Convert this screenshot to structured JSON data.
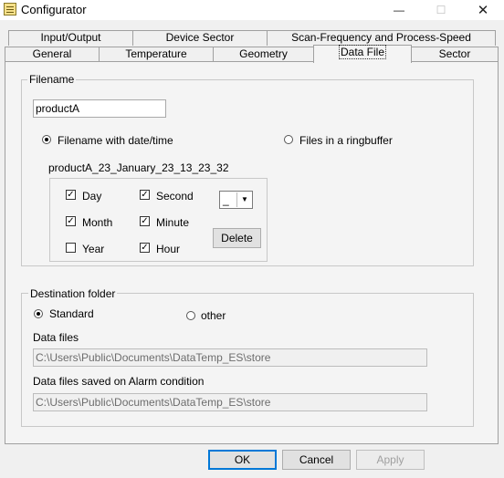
{
  "window": {
    "title": "Configurator",
    "minimize": "—",
    "maximize": "☐",
    "close": "✕"
  },
  "tabs": {
    "row1": [
      "Input/Output",
      "Device Sector",
      "Scan-Frequency and Process-Speed"
    ],
    "row2": [
      "General",
      "Temperature",
      "Geometry",
      "Data File",
      "Sector"
    ],
    "active": "Data File"
  },
  "filename": {
    "legend": "Filename",
    "value": "productA",
    "with_date_label": "Filename with date/time",
    "ringbuffer_label": "Files in a ringbuffer",
    "preview": "productA_23_January_23_13_23_32",
    "checks": {
      "day": "Day",
      "month": "Month",
      "year": "Year",
      "second": "Second",
      "minute": "Minute",
      "hour": "Hour"
    },
    "separator": "_",
    "delete_label": "Delete"
  },
  "destination": {
    "legend": "Destination folder",
    "standard_label": "Standard",
    "other_label": "other",
    "data_files_label": "Data files",
    "data_files_path": "C:\\Users\\Public\\Documents\\DataTemp_ES\\store",
    "alarm_label": "Data files saved on Alarm condition",
    "alarm_path": "C:\\Users\\Public\\Documents\\DataTemp_ES\\store"
  },
  "buttons": {
    "ok": "OK",
    "cancel": "Cancel",
    "apply": "Apply"
  }
}
